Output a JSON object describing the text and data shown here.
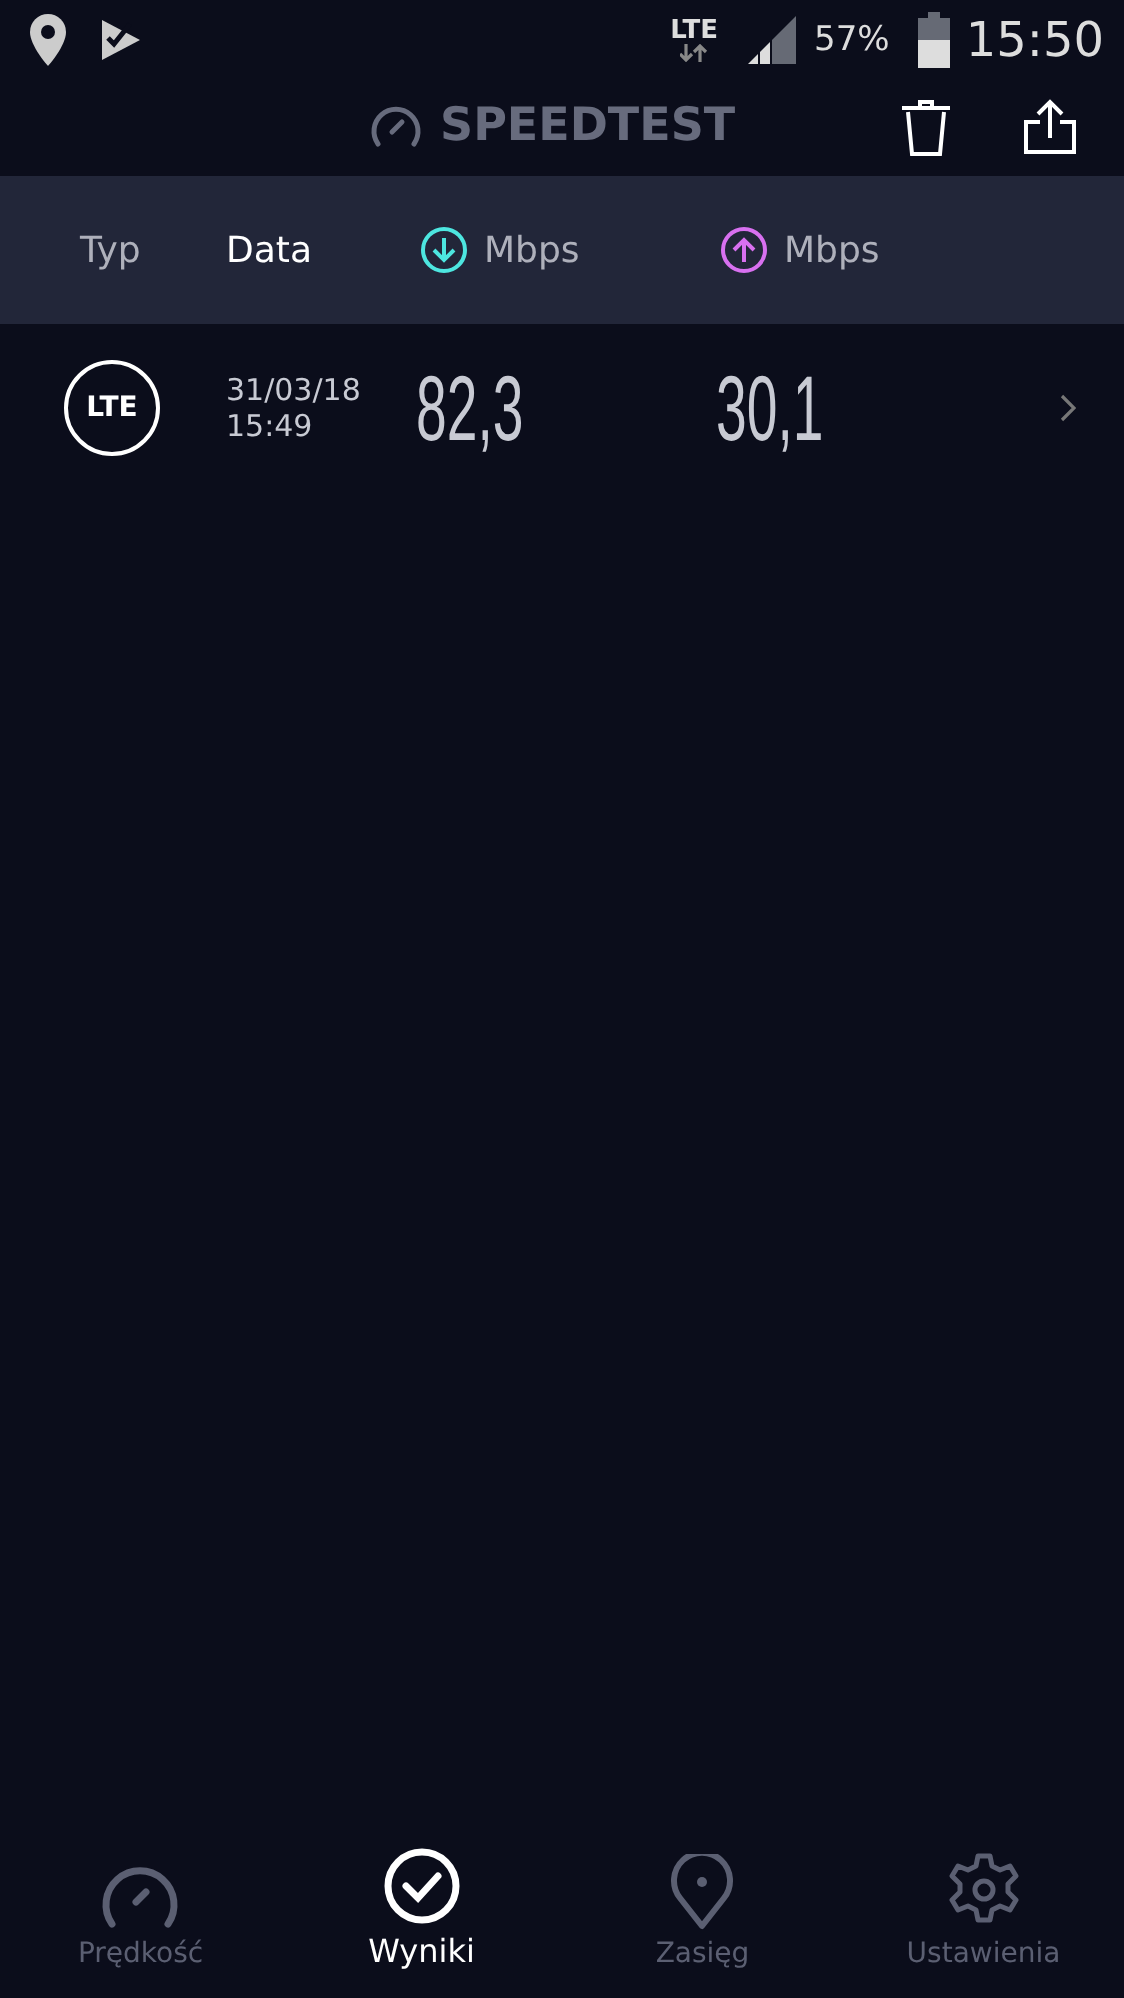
{
  "status_bar": {
    "network": "LTE",
    "battery": "57%",
    "time": "15:50"
  },
  "header": {
    "title": "SPEEDTEST"
  },
  "columns": [
    {
      "kind": "text",
      "label": "Typ",
      "selected": false
    },
    {
      "kind": "text",
      "label": "Data",
      "selected": true
    },
    {
      "kind": "download",
      "label": "Mbps",
      "selected": false,
      "color": "#4de6e0"
    },
    {
      "kind": "upload",
      "label": "Mbps",
      "selected": false,
      "color": "#d870f0"
    }
  ],
  "results": [
    {
      "type": "LTE",
      "date": "31/03/18",
      "time": "15:49",
      "download": "82,3",
      "upload": "30,1"
    }
  ],
  "nav": [
    {
      "kind": "speed",
      "label": "Prędkość",
      "selected": false
    },
    {
      "kind": "results",
      "label": "Wyniki",
      "selected": true
    },
    {
      "kind": "coverage",
      "label": "Zasięg",
      "selected": false
    },
    {
      "kind": "settings",
      "label": "Ustawienia",
      "selected": false
    }
  ]
}
